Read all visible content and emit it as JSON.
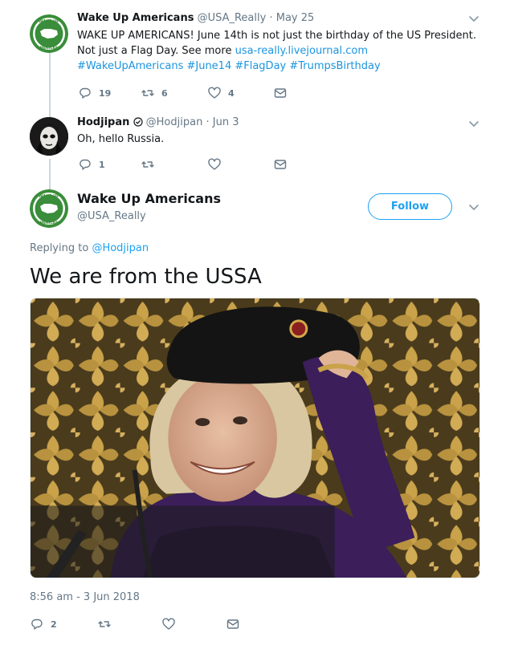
{
  "tweet1": {
    "name": "Wake Up Americans",
    "handle": "@USA_Really",
    "separator": "·",
    "date": "May 25",
    "text_line1": "WAKE UP AMERICANS! June 14th is not just the birthday of the US President.",
    "text_line2_prefix": "Not just a Flag Day. See more ",
    "link": "usa-really.livejournal.com",
    "hashtags": "#WakeUpAmericans #June14  #FlagDay #TrumpsBirthday",
    "replies": "19",
    "retweets": "6",
    "likes": "4"
  },
  "tweet2": {
    "name": "Hodjipan",
    "handle": "@Hodjipan",
    "separator": "·",
    "date": "Jun 3",
    "text": "Oh, hello Russia.",
    "replies": "1"
  },
  "main_tweet": {
    "name": "Wake Up Americans",
    "handle": "@USA_Really",
    "follow_label": "Follow",
    "replying_prefix": "Replying to ",
    "replying_to": "@Hodjipan",
    "text": "We are from the USSA",
    "timestamp": "8:56 am - 3 Jun 2018",
    "replies": "2"
  },
  "logo": {
    "text_top": "WAKE UP",
    "text_bottom": "AMERICANS"
  },
  "colors": {
    "accent": "#1da1f2",
    "link": "#1b95e0",
    "muted": "#657786",
    "logo_green": "#3a8d3a"
  },
  "icons": {
    "reply": "reply-icon",
    "retweet": "retweet-icon",
    "like": "heart-icon",
    "message": "envelope-icon",
    "caret": "chevron-down-icon",
    "verified": "badge-icon"
  }
}
